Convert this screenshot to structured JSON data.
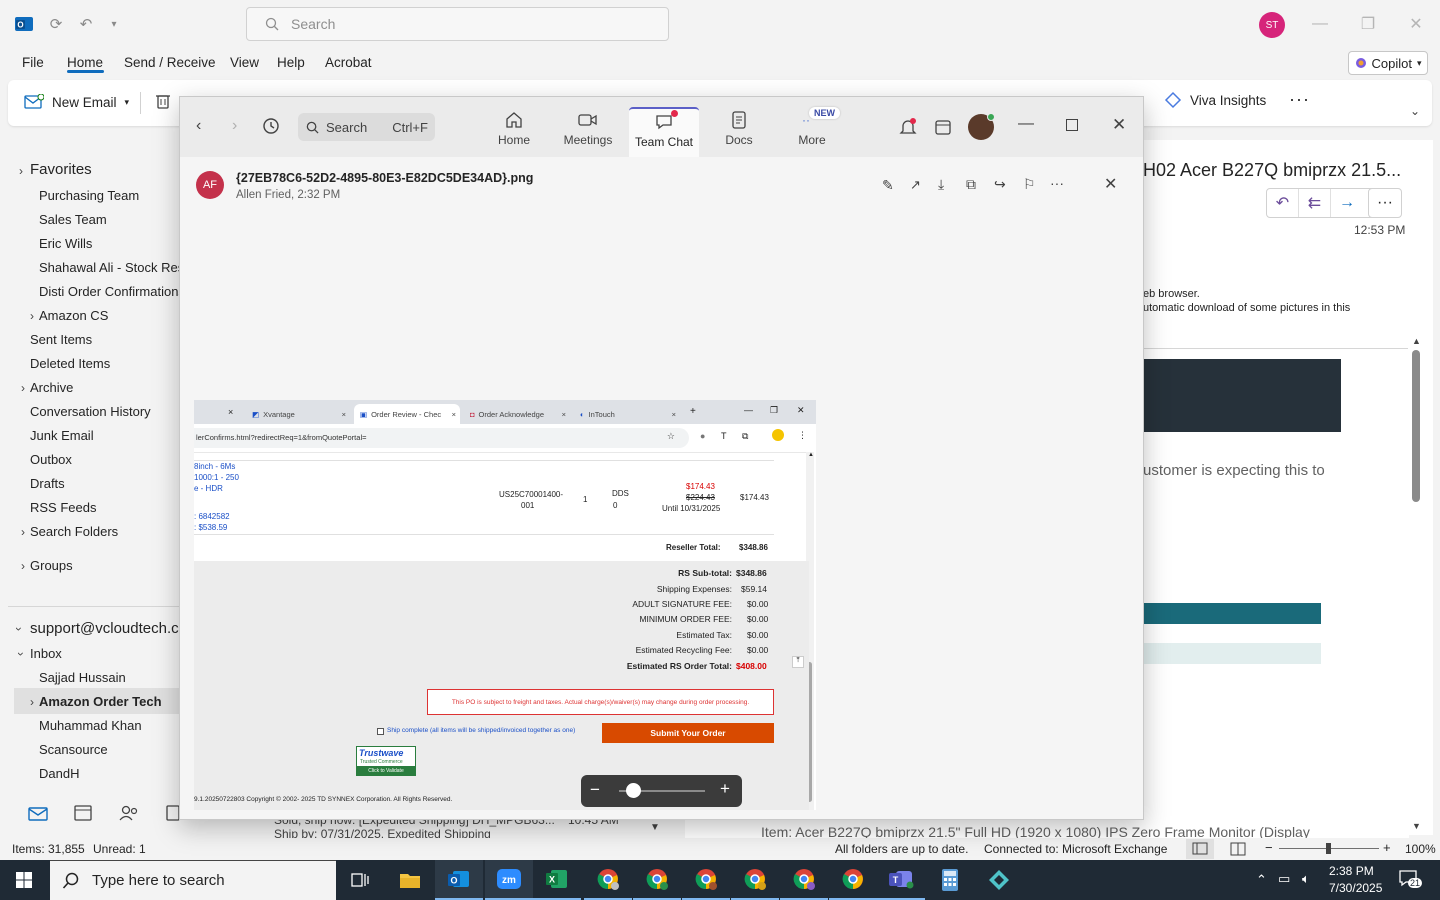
{
  "outlook": {
    "search_placeholder": "Search",
    "account_initials": "ST",
    "menu": [
      "File",
      "Home",
      "Send / Receive",
      "View",
      "Help",
      "Acrobat"
    ],
    "copilot_label": "Copilot",
    "new_email_label": "New Email",
    "viva_label": "Viva Insights",
    "favorites_label": "Favorites",
    "folders": [
      "Purchasing Team",
      "Sales Team",
      "Eric Wills",
      "Shahawal Ali - Stock Reser",
      "Disti Order Confirmations",
      "Amazon CS",
      "Sent Items",
      "Deleted Items",
      "Archive",
      "Conversation History",
      "Junk Email",
      "Outbox",
      "Drafts",
      "RSS Feeds",
      "Search Folders",
      "Groups"
    ],
    "account": "support@vcloudtech.c",
    "inbox_label": "Inbox",
    "inbox_folders": [
      "Sajjad Hussain",
      "Amazon Order Tech",
      "Muhammad Khan",
      "Scansource",
      "DandH"
    ],
    "reading_subject": "H02 Acer B227Q bmiprzx 21.5...",
    "reading_time": "12:53 PM",
    "reading_info_1": "eb browser.",
    "reading_info_2": "utomatic download of some pictures in this",
    "reading_body": "ustomer is expecting this to",
    "reading_item": "Item: Acer B227Q bmiprzx 21.5\" Full HD (1920 x 1080) IPS Zero Frame Monitor (Display",
    "list_partial_1": "Sold, ship now: [Expedited Shipping] DH_MPGB63...",
    "list_partial_time": "10:45 AM",
    "list_partial_2": "Ship by: 07/31/2025. Expedited Shipping",
    "status": {
      "items": "Items: 31,855",
      "unread": "Unread: 1",
      "sync": "All folders are up to date.",
      "connected": "Connected to: Microsoft Exchange",
      "zoom": "100%"
    }
  },
  "teams": {
    "search_label": "Search",
    "search_shortcut": "Ctrl+F",
    "nav": [
      "Home",
      "Meetings",
      "Team Chat",
      "Docs",
      "More"
    ],
    "new_badge": "NEW",
    "file_name": "{27EB78C6-52D2-4895-80E3-E82DC5DE34AD}.png",
    "sender_initials": "AF",
    "sender_line": "Allen Fried, 2:32 PM"
  },
  "embedded": {
    "tabs": [
      "Xvantage",
      "Order Review - Chec",
      "Order Acknowledge",
      "InTouch"
    ],
    "url": "lerConfirms.html?redirectReq=1&fromQuotePortal=",
    "left_lines": [
      "8inch - 6Ms",
      "1000:1 - 250",
      "e - HDR",
      ": 6842582",
      ": $538.59"
    ],
    "line_item": {
      "part_1": "US25C70001400-",
      "part_2": "001",
      "qty": "1",
      "ship": "DDS",
      "ship2": "0",
      "price_new": "$174.43",
      "price_old": "$224.43",
      "until": "Until 10/31/2025",
      "total": "$174.43"
    },
    "reseller_total_label": "Reseller Total:",
    "reseller_total": "$348.86",
    "summary": [
      {
        "label": "RS Sub-total:",
        "value": "$348.86",
        "bold": true
      },
      {
        "label": "Shipping Expenses:",
        "value": "$59.14"
      },
      {
        "label": "ADULT SIGNATURE FEE:",
        "value": "$0.00"
      },
      {
        "label": "MINIMUM ORDER FEE:",
        "value": "$0.00"
      },
      {
        "label": "Estimated Tax:",
        "value": "$0.00"
      },
      {
        "label": "Estimated Recycling Fee:",
        "value": "$0.00"
      },
      {
        "label": "Estimated RS Order Total:",
        "value": "$408.00",
        "bold": true
      }
    ],
    "notice": "This PO is subject to freight and taxes. Actual charge(s)/waiver(s) may change during order processing.",
    "ship_complete": "Ship complete (all items will be shipped/invoiced together as one)",
    "submit_label": "Submit Your Order",
    "trustwave": "Trustwave",
    "trustwave_sub": "Trusted Commerce",
    "trustwave_click": "Click to Validate",
    "copyright": "9.1.20250722803 Copyright © 2002- 2025 TD SYNNEX Corporation. All Rights Reserved."
  },
  "taskbar": {
    "search_placeholder": "Type here to search",
    "time": "2:38 PM",
    "date": "7/30/2025",
    "notif_count": "21"
  },
  "colors": {
    "accent": "#0f6cbd",
    "teams_accent": "#5b5fc7",
    "submit_orange": "#d84a00",
    "price_red": "#d80000"
  }
}
